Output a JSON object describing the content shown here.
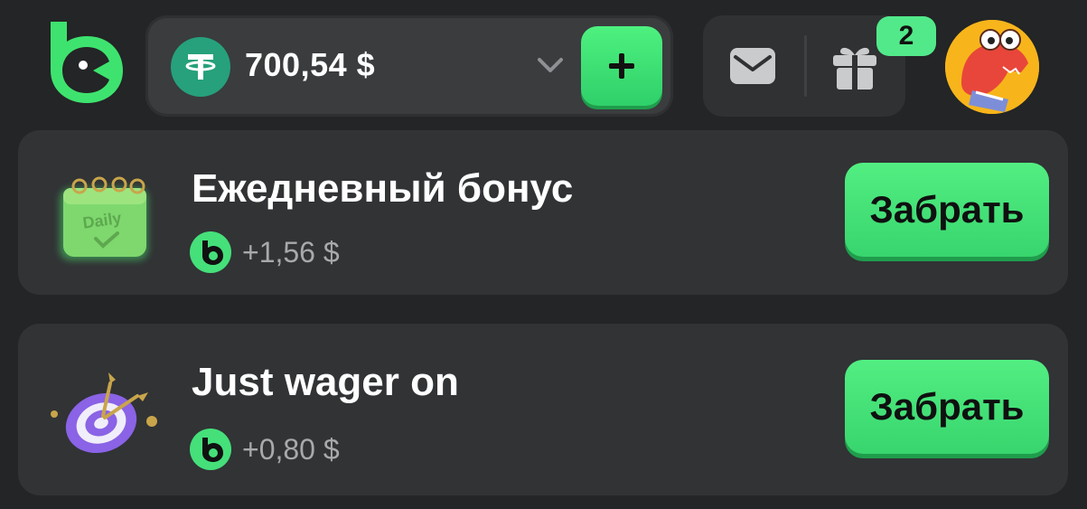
{
  "header": {
    "logo_icon": "bc-game-logo-icon",
    "balance": {
      "currency_icon": "tether-icon",
      "amount": "700,54 $"
    },
    "add_funds_icon": "plus-icon",
    "mail_icon": "mail-icon",
    "gift_icon": "gift-icon",
    "notification_count": "2",
    "avatar_icon": "crocodile-avatar"
  },
  "bonuses": [
    {
      "title": "Ежедневный бонус",
      "illustration_label": "Daily",
      "reward": "+1,56 $",
      "claim_label": "Забрать"
    },
    {
      "title": "Just wager on",
      "reward": "+0,80 $",
      "claim_label": "Забрать"
    }
  ],
  "colors": {
    "background": "#232526",
    "accent_green": "#4ef17f",
    "card": "#313335",
    "tether": "#26a17b"
  }
}
